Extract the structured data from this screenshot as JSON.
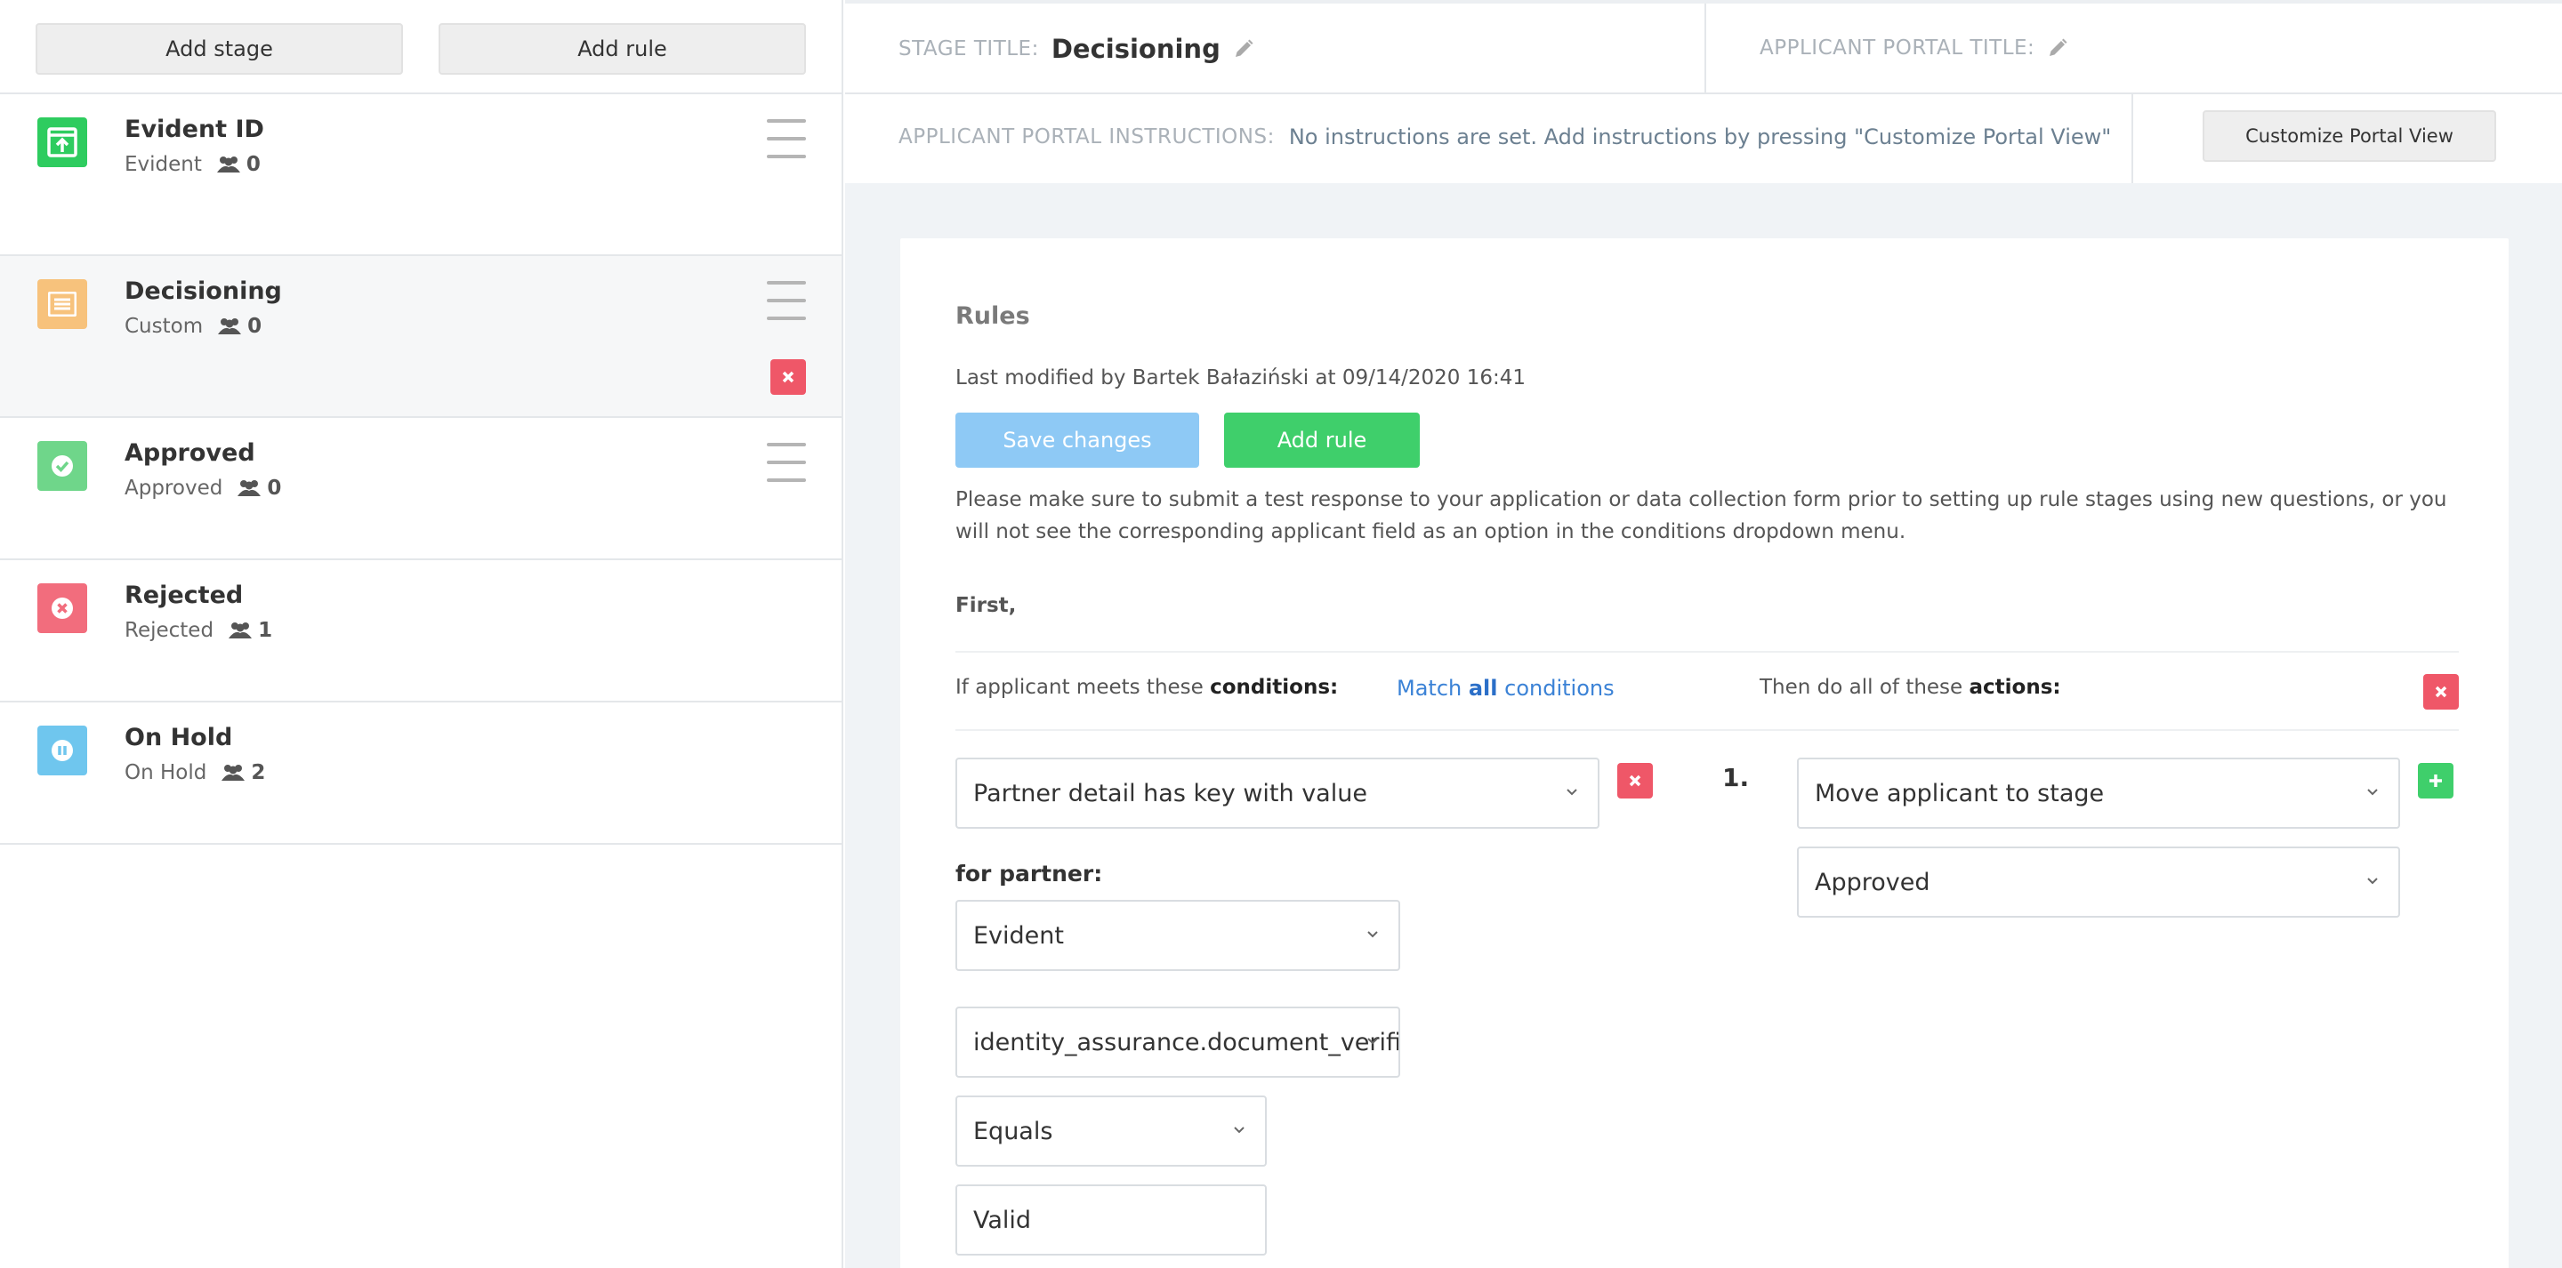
{
  "sidebar": {
    "add_stage_label": "Add stage",
    "add_rule_label": "Add rule",
    "stages": [
      {
        "title": "Evident ID",
        "type": "Evident",
        "count": "0",
        "icon": "upload-box-icon",
        "color": "#2ecc5f"
      },
      {
        "title": "Decisioning",
        "type": "Custom",
        "count": "0",
        "icon": "list-icon",
        "color": "#f7c27c"
      },
      {
        "title": "Approved",
        "type": "Approved",
        "count": "0",
        "icon": "check-circle-icon",
        "color": "#6fd68a"
      },
      {
        "title": "Rejected",
        "type": "Rejected",
        "count": "1",
        "icon": "x-circle-icon",
        "color": "#f26d7d"
      },
      {
        "title": "On Hold",
        "type": "On Hold",
        "count": "2",
        "icon": "pause-circle-icon",
        "color": "#6fc6ee"
      }
    ]
  },
  "header": {
    "stage_title_label": "STAGE TITLE:",
    "stage_title_value": "Decisioning",
    "portal_title_label": "APPLICANT PORTAL TITLE:",
    "instructions_label": "APPLICANT PORTAL INSTRUCTIONS:",
    "instructions_value": "No instructions are set. Add instructions by pressing \"Customize Portal View\"",
    "customize_label": "Customize Portal View"
  },
  "rules": {
    "title": "Rules",
    "last_modified": "Last modified by Bartek Bałaziński at 09/14/2020 16:41",
    "save_label": "Save changes",
    "add_rule_label": "Add rule",
    "note": "Please make sure to submit a test response to your application or data collection form prior to setting up rule stages using new questions, or you will not see the corresponding applicant field as an option in the conditions dropdown menu.",
    "first_label": "First,",
    "conditions_prefix": "If applicant meets these ",
    "conditions_bold": "conditions:",
    "match_prefix": "Match ",
    "match_bold": "all",
    "match_suffix": " conditions",
    "actions_prefix": "Then do all of these ",
    "actions_bold": "actions:",
    "condition_select": "Partner detail has key with value",
    "for_partner_label": "for partner:",
    "partner_select": "Evident",
    "key_select": "identity_assurance.document_verification",
    "operator_select": "Equals",
    "value_input": "Valid",
    "action_number": "1.",
    "action_select": "Move applicant to stage",
    "target_stage_select": "Approved"
  }
}
